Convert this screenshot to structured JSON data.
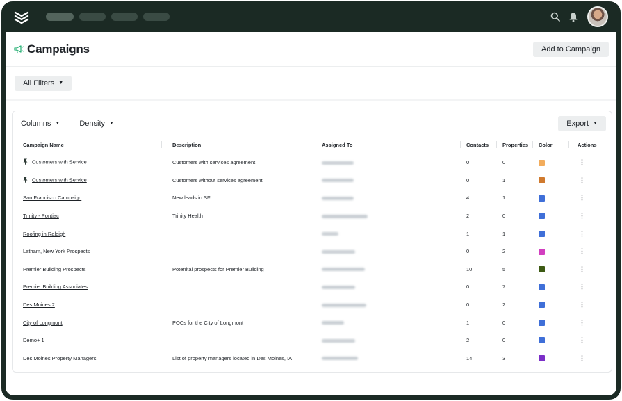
{
  "header": {
    "title": "Campaigns",
    "add_button": "Add to Campaign"
  },
  "filters": {
    "all_filters_label": "All Filters"
  },
  "toolbar": {
    "columns_label": "Columns",
    "density_label": "Density",
    "export_label": "Export"
  },
  "table": {
    "columns": [
      "Campaign Name",
      "Description",
      "Assigned To",
      "Contacts",
      "Properties",
      "Color",
      "Actions"
    ],
    "rows": [
      {
        "pinned": true,
        "name": "Customers with Service",
        "description": "Customers with services agreement",
        "contacts": "0",
        "properties": "0",
        "color": "#f2ac5c"
      },
      {
        "pinned": true,
        "name": "Customers with Service",
        "description": "Customers without services agreement",
        "contacts": "0",
        "properties": "1",
        "color": "#d07a2e"
      },
      {
        "pinned": false,
        "name": "San Francisco Campaign",
        "description": "New leads in SF",
        "contacts": "4",
        "properties": "1",
        "color": "#3f6fd8"
      },
      {
        "pinned": false,
        "name": "Trinity - Pontiac",
        "description": "Trinity Health",
        "contacts": "2",
        "properties": "0",
        "color": "#3f6fd8"
      },
      {
        "pinned": false,
        "name": "Roofing in Raleigh",
        "description": "",
        "contacts": "1",
        "properties": "1",
        "color": "#3f6fd8"
      },
      {
        "pinned": false,
        "name": "Latham, New York Prospects",
        "description": "",
        "contacts": "0",
        "properties": "2",
        "color": "#d23fc0"
      },
      {
        "pinned": false,
        "name": "Premier Building Prospects",
        "description": "Potenital prospects for Premier Building",
        "contacts": "10",
        "properties": "5",
        "color": "#3d5a14"
      },
      {
        "pinned": false,
        "name": "Premier Building Associates",
        "description": "",
        "contacts": "0",
        "properties": "7",
        "color": "#3f6fd8"
      },
      {
        "pinned": false,
        "name": "Des Moines 2",
        "description": "",
        "contacts": "0",
        "properties": "2",
        "color": "#3f6fd8"
      },
      {
        "pinned": false,
        "name": "City of Longmont",
        "description": "POCs for the City of Longmont",
        "contacts": "1",
        "properties": "0",
        "color": "#3f6fd8"
      },
      {
        "pinned": false,
        "name": "Demo+ 1",
        "description": "",
        "contacts": "2",
        "properties": "0",
        "color": "#3f6fd8"
      },
      {
        "pinned": false,
        "name": "Des Moines Property Managers",
        "description": "List of property managers located in Des Moines, IA",
        "contacts": "14",
        "properties": "3",
        "color": "#7b2fc8"
      }
    ]
  },
  "colors": {
    "topbar": "#1b2a24",
    "accent": "#2fb37a"
  },
  "icons": {
    "logo": "layers-logo-icon",
    "search": "search-icon",
    "bell": "bell-icon",
    "megaphone": "megaphone-icon",
    "pin": "pin-icon",
    "actions": "kebab-icon"
  }
}
